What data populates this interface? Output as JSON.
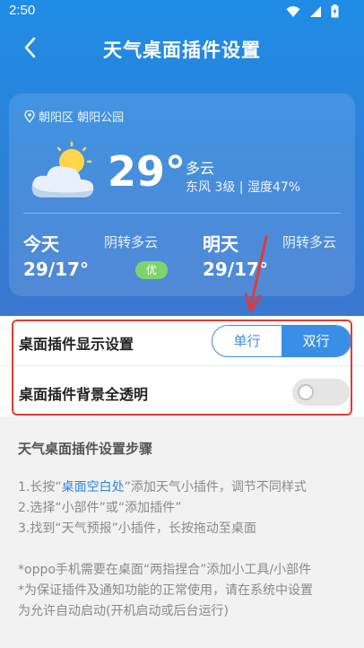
{
  "status": {
    "time": "2:50"
  },
  "nav": {
    "title": "天气桌面插件设置"
  },
  "weather": {
    "location": "朝阳区 朝阳公园",
    "temperature": "29°",
    "condition": "多云",
    "wind_humidity": "东风 3级 | 湿度47%",
    "today": {
      "label": "今天",
      "desc": "阴转多云",
      "range": "29/17°",
      "aqi": "优"
    },
    "tomorrow": {
      "label": "明天",
      "desc": "阴转多云",
      "range": "29/17°"
    }
  },
  "settings": {
    "display_label": "桌面插件显示设置",
    "option_single": "单行",
    "option_double": "双行",
    "selected": "双行",
    "transparent_label": "桌面插件背景全透明",
    "transparent_on": false
  },
  "steps": {
    "title": "天气桌面插件设置步骤",
    "line1_prefix": "1.长按“",
    "line1_highlight": "桌面空白处",
    "line1_suffix": "”添加天气小插件，调节不同样式",
    "line2": "2.选择“小部件”或“添加插件”",
    "line3": "3.找到“天气预报”小插件，长按拖动至桌面",
    "note1": "*oppo手机需要在桌面“两指捏合”添加小工具/小部件",
    "note2": "*为保证插件及通知功能的正常使用，请在系统中设置",
    "note3": "为允许自动启动(开机启动或后台运行)"
  },
  "colors": {
    "header_blue": "#1f8de6",
    "accent": "#3a8ee6",
    "highlight_red": "#e53935",
    "aqi_green": "#7fd36b"
  }
}
